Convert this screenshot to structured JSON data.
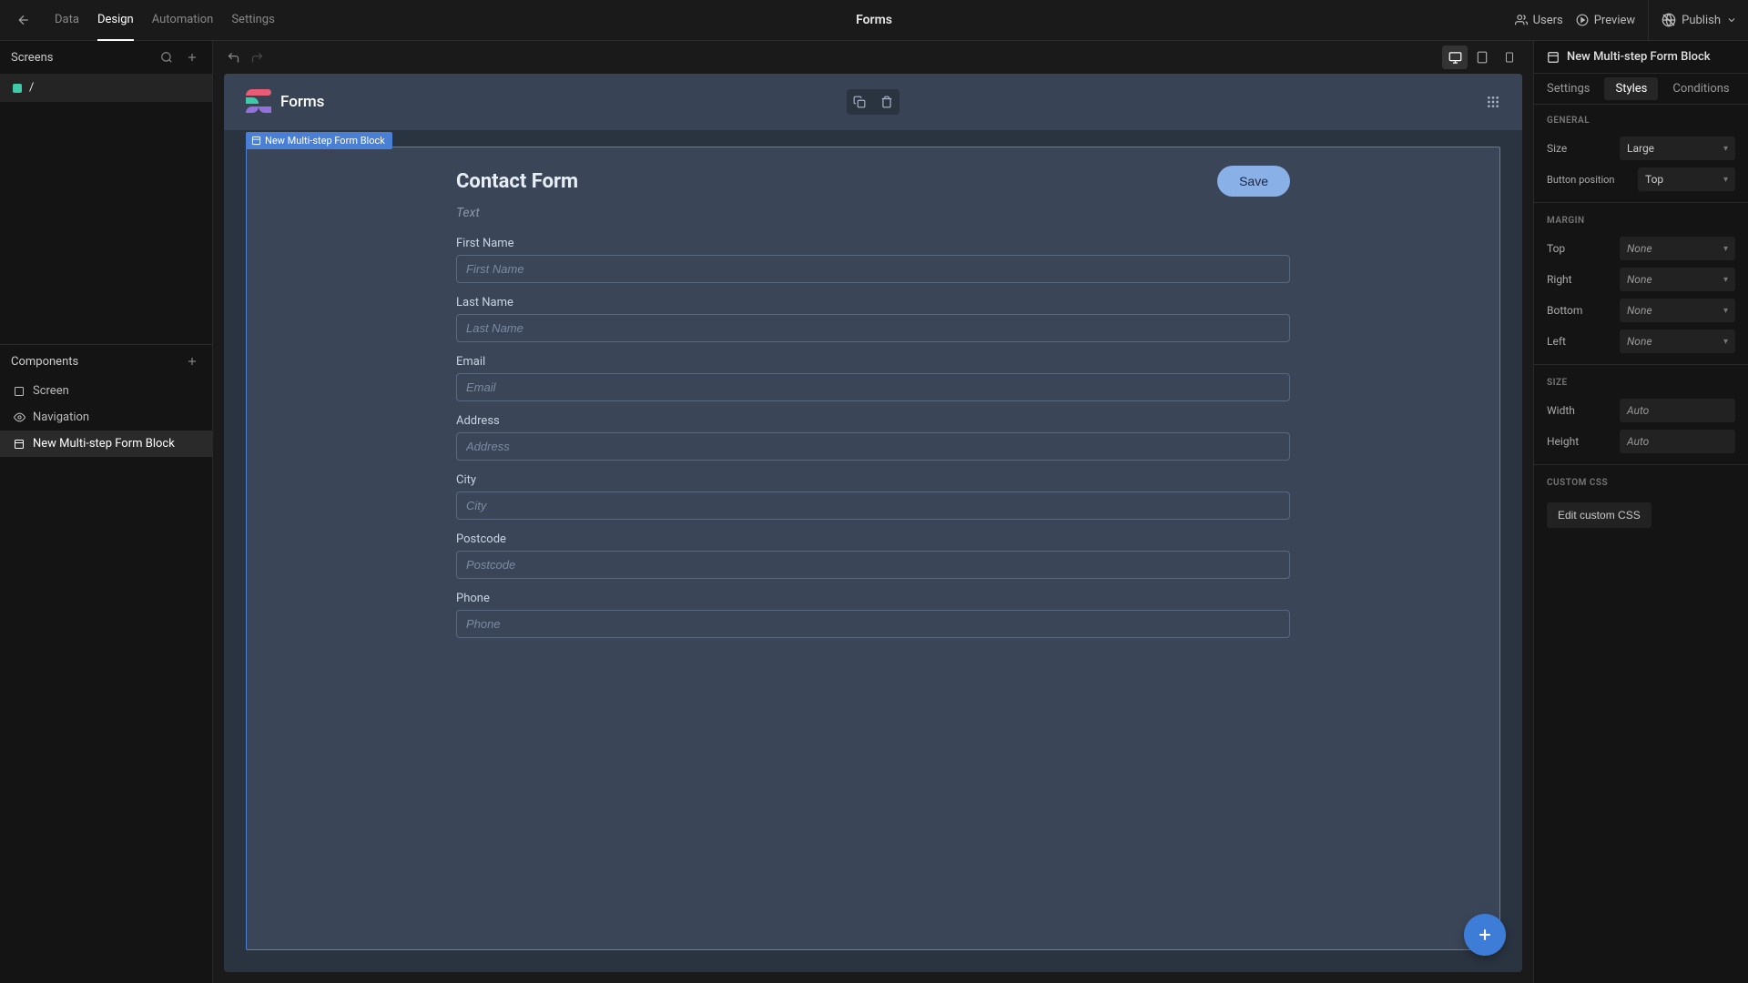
{
  "topbar": {
    "nav": [
      "Data",
      "Design",
      "Automation",
      "Settings"
    ],
    "activeNav": 1,
    "title": "Forms",
    "users_label": "Users",
    "preview_label": "Preview",
    "publish_label": "Publish"
  },
  "leftSidebar": {
    "screens_title": "Screens",
    "screen_name": "/",
    "components_title": "Components",
    "components": [
      {
        "label": "Screen",
        "icon": "square"
      },
      {
        "label": "Navigation",
        "icon": "eye"
      },
      {
        "label": "New Multi-step Form Block",
        "icon": "form",
        "active": true
      }
    ]
  },
  "canvas": {
    "header_title": "Forms",
    "block_tag": "New Multi-step Form Block",
    "form_title": "Contact Form",
    "save_label": "Save",
    "subtitle_placeholder": "Text",
    "fields": [
      {
        "label": "First Name",
        "placeholder": "First Name"
      },
      {
        "label": "Last Name",
        "placeholder": "Last Name"
      },
      {
        "label": "Email",
        "placeholder": "Email"
      },
      {
        "label": "Address",
        "placeholder": "Address"
      },
      {
        "label": "City",
        "placeholder": "City"
      },
      {
        "label": "Postcode",
        "placeholder": "Postcode"
      },
      {
        "label": "Phone",
        "placeholder": "Phone"
      }
    ]
  },
  "rightSidebar": {
    "title": "New Multi-step Form Block",
    "tabs": [
      "Settings",
      "Styles",
      "Conditions"
    ],
    "activeTab": 1,
    "general_title": "GENERAL",
    "size_label": "Size",
    "size_value": "Large",
    "button_pos_label": "Button position",
    "button_pos_value": "Top",
    "margin_title": "MARGIN",
    "margin_top_label": "Top",
    "margin_top_value": "None",
    "margin_right_label": "Right",
    "margin_right_value": "None",
    "margin_bottom_label": "Bottom",
    "margin_bottom_value": "None",
    "margin_left_label": "Left",
    "margin_left_value": "None",
    "size_section_title": "SIZE",
    "width_label": "Width",
    "width_value": "Auto",
    "height_label": "Height",
    "height_value": "Auto",
    "custom_css_title": "CUSTOM CSS",
    "custom_css_button": "Edit custom CSS"
  }
}
